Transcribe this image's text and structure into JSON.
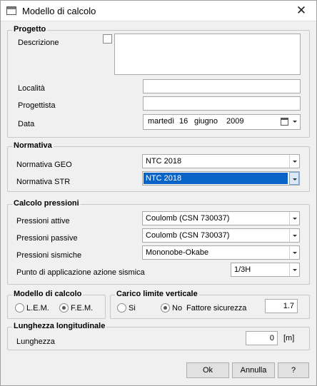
{
  "window": {
    "title": "Modello di calcolo",
    "close_glyph": "✕"
  },
  "progetto": {
    "legend": "Progetto",
    "descrizione_label": "Descrizione",
    "descrizione_value": "",
    "localita_label": "Località",
    "localita_value": "",
    "progettista_label": "Progettista",
    "progettista_value": "",
    "data_label": "Data",
    "date": {
      "weekday": "martedì",
      "day": "16",
      "month": "giugno",
      "year": "2009"
    }
  },
  "normativa": {
    "legend": "Normativa",
    "geo_label": "Normativa GEO",
    "geo_value": "NTC 2018",
    "str_label": "Normativa STR",
    "str_value": "NTC 2018"
  },
  "calcolo_pressioni": {
    "legend": "Calcolo pressioni",
    "attive_label": "Pressioni attive",
    "attive_value": "Coulomb (CSN 730037)",
    "passive_label": "Pressioni passive",
    "passive_value": "Coulomb (CSN 730037)",
    "sismiche_label": "Pressioni sismiche",
    "sismiche_value": "Mononobe-Okabe",
    "punto_label": "Punto di applicazione azione sismica",
    "punto_value": "1/3H"
  },
  "modello_calcolo": {
    "legend": "Modello di calcolo",
    "options": [
      {
        "label": "L.E.M.",
        "selected": false
      },
      {
        "label": "F.E.M.",
        "selected": true
      }
    ]
  },
  "carico_limite": {
    "legend": "Carico limite verticale",
    "options": [
      {
        "label": "Si",
        "selected": false
      },
      {
        "label": "No",
        "selected": true
      }
    ],
    "fattore_label": "Fattore sicurezza",
    "fattore_value": "1.7"
  },
  "lunghezza": {
    "legend": "Lunghezza longitudinale",
    "label": "Lunghezza",
    "value": "0",
    "unit": "[m]"
  },
  "buttons": {
    "ok": "Ok",
    "annulla": "Annulla",
    "help": "?"
  },
  "colors": {
    "selection": "#0a64c8",
    "background": "#f0f0f0"
  }
}
